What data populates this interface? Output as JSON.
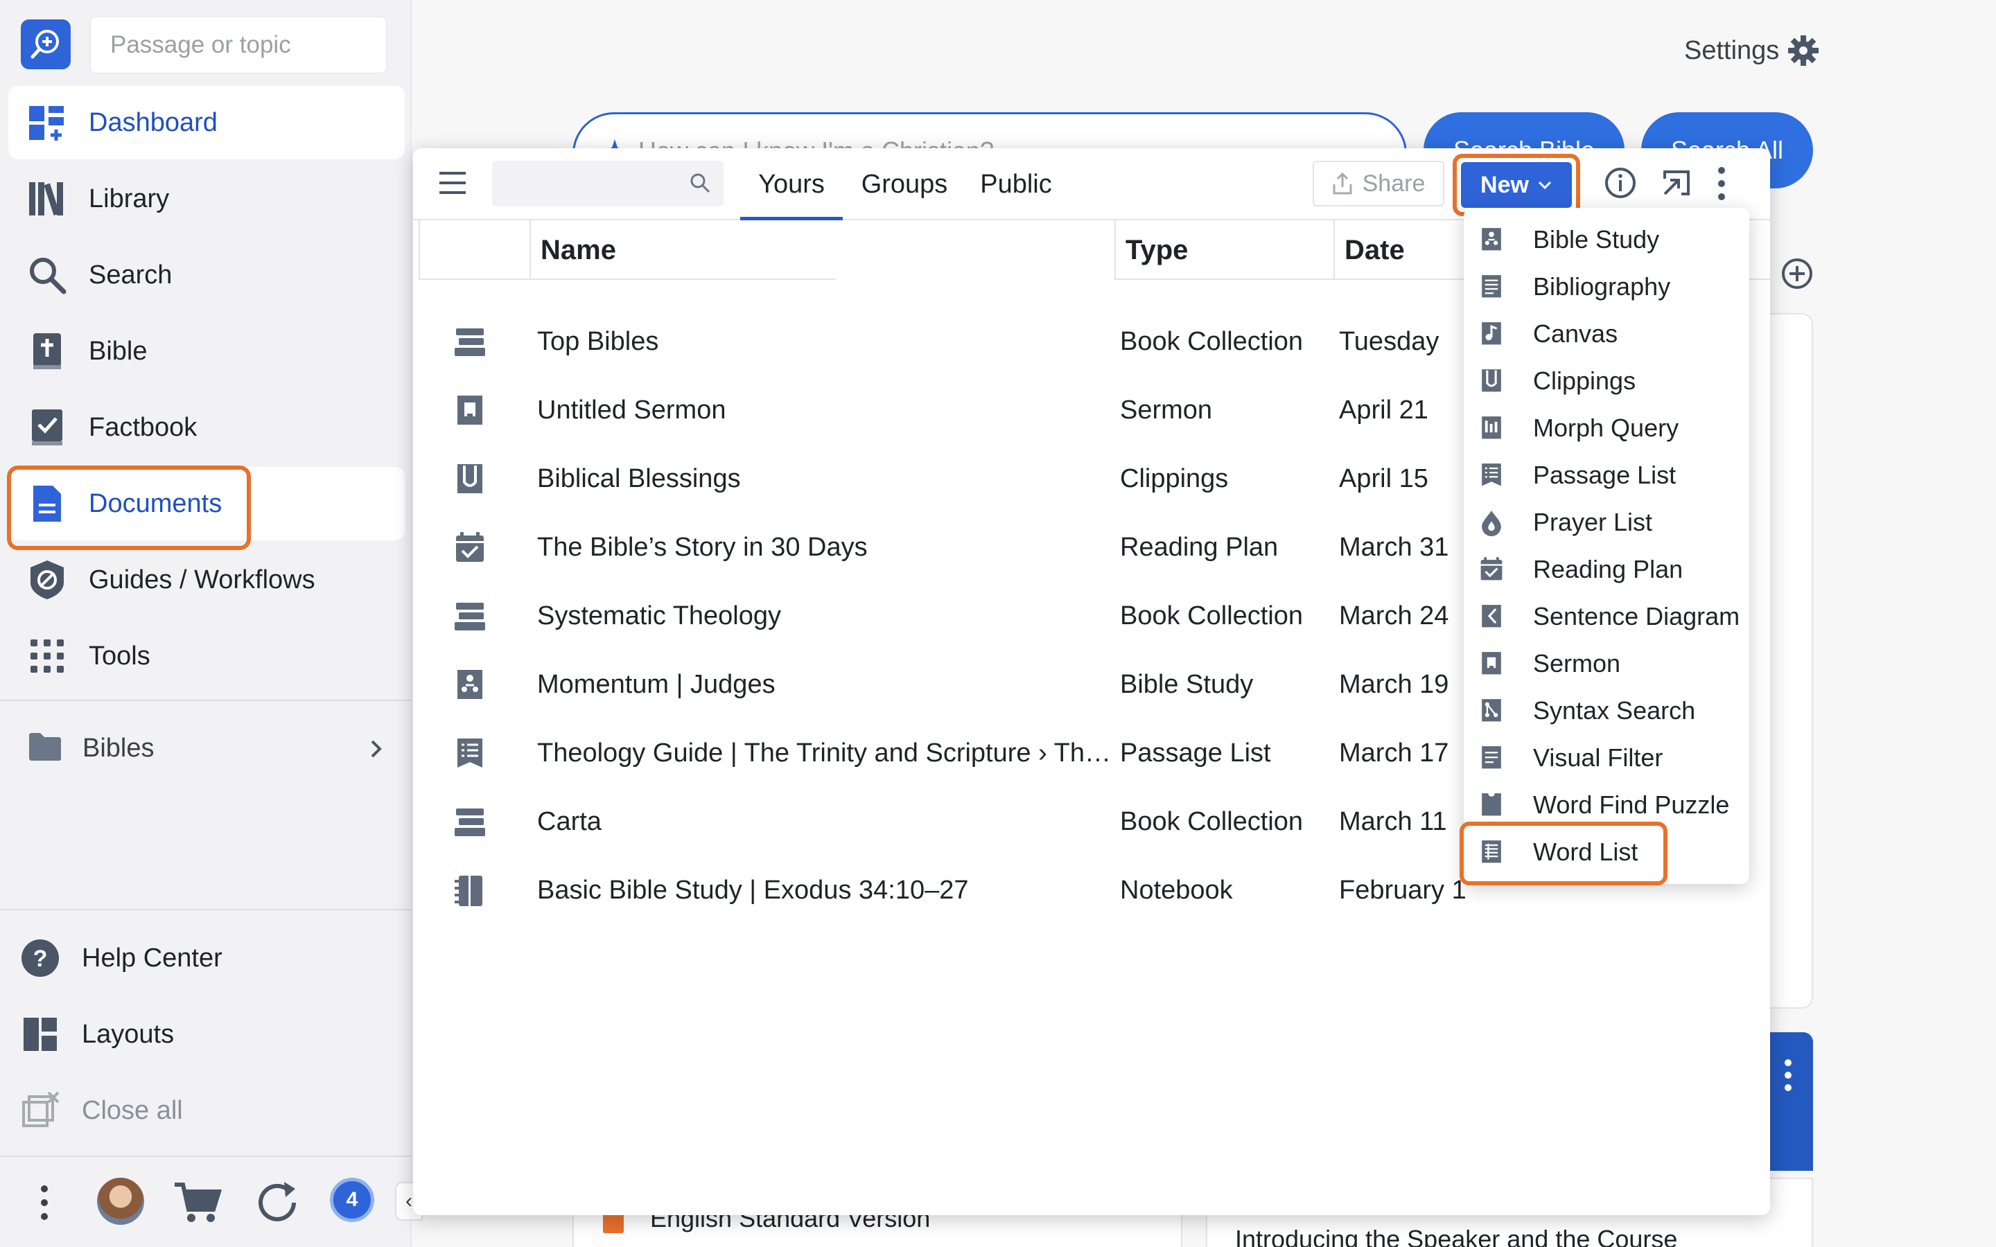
{
  "sidebar": {
    "search_placeholder": "Passage or topic",
    "items": [
      {
        "label": "Dashboard",
        "icon": "dashboard-icon"
      },
      {
        "label": "Library",
        "icon": "library-icon"
      },
      {
        "label": "Search",
        "icon": "search-icon"
      },
      {
        "label": "Bible",
        "icon": "bible-icon"
      },
      {
        "label": "Factbook",
        "icon": "factbook-icon"
      },
      {
        "label": "Documents",
        "icon": "document-icon"
      },
      {
        "label": "Guides / Workflows",
        "icon": "guides-icon"
      },
      {
        "label": "Tools",
        "icon": "tools-grid-icon"
      }
    ],
    "bibles_label": "Bibles",
    "bottom_items": [
      {
        "label": "Help Center",
        "icon": "help-icon"
      },
      {
        "label": "Layouts",
        "icon": "layouts-icon"
      },
      {
        "label": "Close all",
        "icon": "close-all-icon"
      }
    ],
    "notification_count": "4"
  },
  "header": {
    "settings_label": "Settings",
    "ai_search_placeholder": "How can I know I'm a Christian?",
    "search_bible_label": "Search Bible",
    "search_all_label": "Search All"
  },
  "background": {
    "esv_label": "English Standard Version",
    "course_label": "Introducing the Speaker and the Course"
  },
  "documents_panel": {
    "tabs": [
      "Yours",
      "Groups",
      "Public"
    ],
    "share_label": "Share",
    "new_label": "New",
    "columns": [
      "Name",
      "Type",
      "Date"
    ],
    "rows": [
      {
        "name": "Top Bibles",
        "type": "Book Collection",
        "date": "Tuesday",
        "icon": "book-collection-icon"
      },
      {
        "name": "Untitled Sermon",
        "type": "Sermon",
        "date": "April 21",
        "icon": "sermon-icon"
      },
      {
        "name": "Biblical Blessings",
        "type": "Clippings",
        "date": "April 15",
        "icon": "clippings-icon"
      },
      {
        "name": "The Bible’s Story in 30 Days",
        "type": "Reading Plan",
        "date": "March 31",
        "icon": "reading-plan-icon"
      },
      {
        "name": "Systematic Theology",
        "type": "Book Collection",
        "date": "March 24",
        "icon": "book-collection-icon"
      },
      {
        "name": "Momentum | Judges",
        "type": "Bible Study",
        "date": "March 19",
        "icon": "bible-study-icon"
      },
      {
        "name": "Theology Guide | The Trinity and Scripture › Th…",
        "type": "Passage List",
        "date": "March 17",
        "icon": "passage-list-icon"
      },
      {
        "name": "Carta",
        "type": "Book Collection",
        "date": "March 11",
        "icon": "book-collection-icon"
      },
      {
        "name": "Basic Bible Study | Exodus 34:10–27",
        "type": "Notebook",
        "date": "February 1",
        "icon": "notebook-icon"
      }
    ]
  },
  "new_menu": {
    "items": [
      {
        "label": "Bible Study",
        "icon": "bible-study-icon"
      },
      {
        "label": "Bibliography",
        "icon": "bibliography-icon"
      },
      {
        "label": "Canvas",
        "icon": "canvas-icon"
      },
      {
        "label": "Clippings",
        "icon": "clippings-icon"
      },
      {
        "label": "Morph Query",
        "icon": "morph-query-icon"
      },
      {
        "label": "Passage List",
        "icon": "passage-list-icon"
      },
      {
        "label": "Prayer List",
        "icon": "prayer-list-icon"
      },
      {
        "label": "Reading Plan",
        "icon": "reading-plan-icon"
      },
      {
        "label": "Sentence Diagram",
        "icon": "sentence-diagram-icon"
      },
      {
        "label": "Sermon",
        "icon": "sermon-icon"
      },
      {
        "label": "Syntax Search",
        "icon": "syntax-search-icon"
      },
      {
        "label": "Visual Filter",
        "icon": "visual-filter-icon"
      },
      {
        "label": "Word Find Puzzle",
        "icon": "word-find-puzzle-icon"
      },
      {
        "label": "Word List",
        "icon": "word-list-icon"
      }
    ]
  },
  "colors": {
    "accent_blue": "#2f63d8",
    "highlight_orange": "#e8712b",
    "icon_gray": "#5f6b7a"
  }
}
